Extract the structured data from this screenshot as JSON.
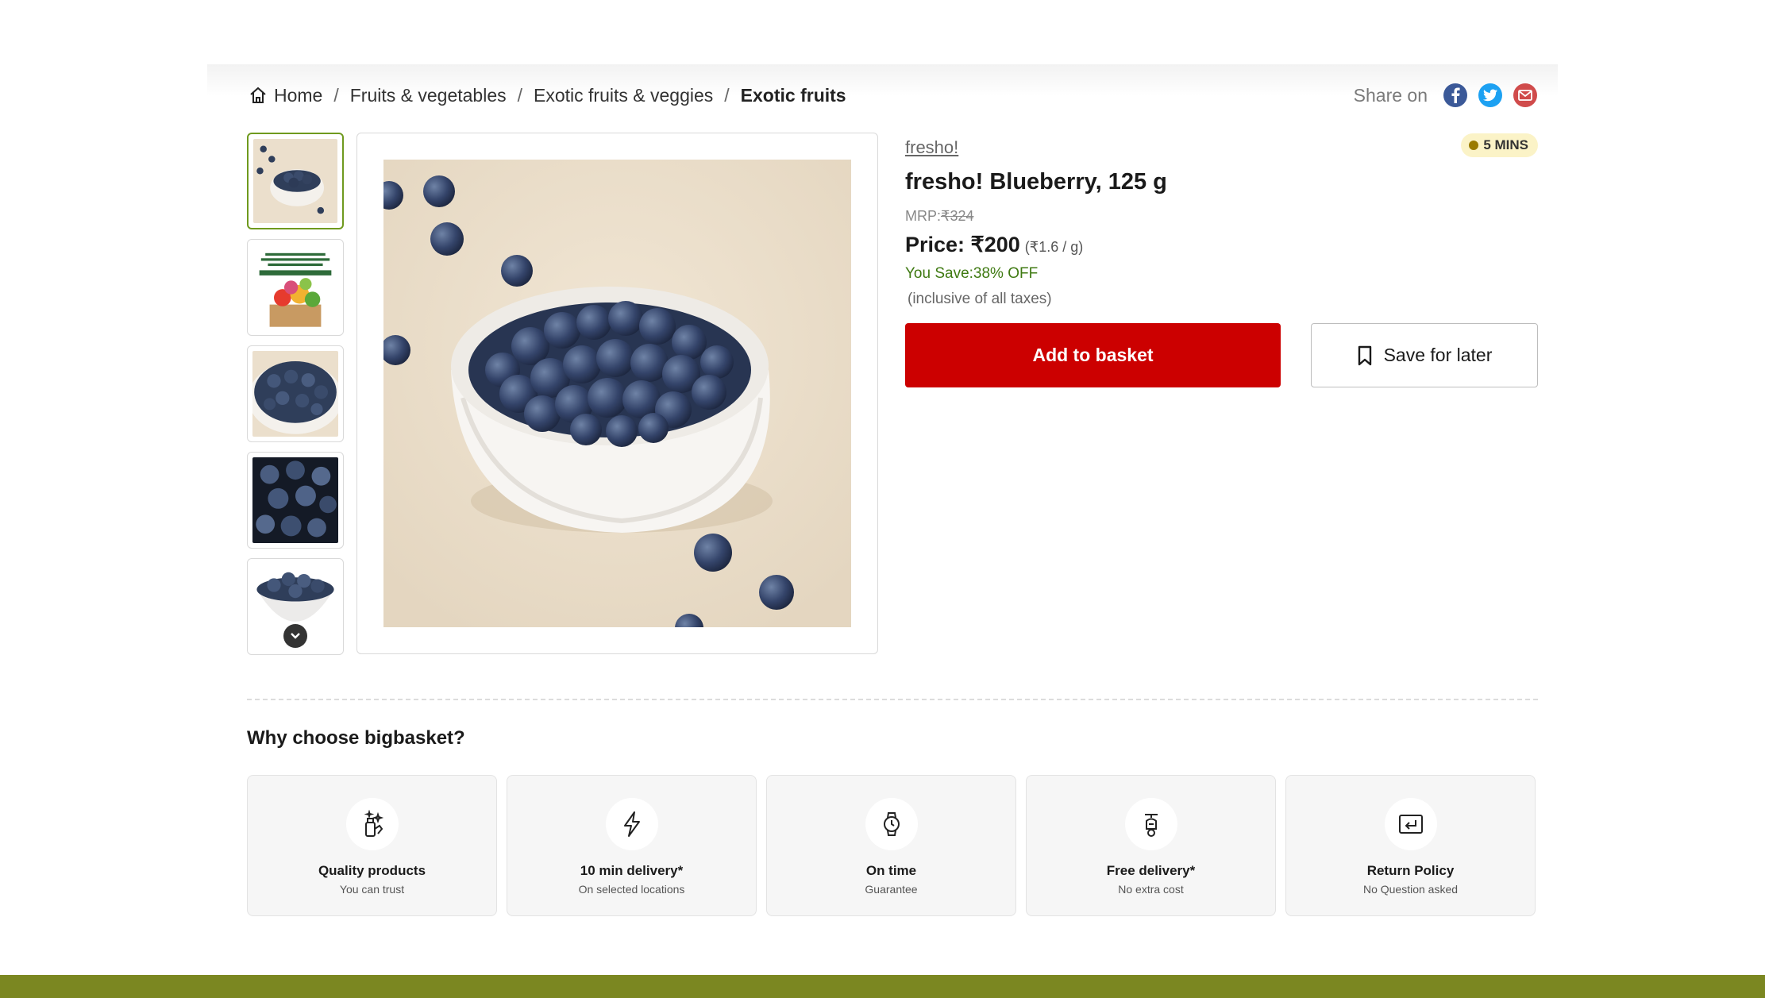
{
  "breadcrumb": {
    "home": "Home",
    "items": [
      "Fruits & vegetables",
      "Exotic fruits & veggies",
      "Exotic fruits"
    ],
    "separator": "/"
  },
  "share": {
    "label": "Share on",
    "icons": [
      "facebook-icon",
      "twitter-icon",
      "email-icon"
    ]
  },
  "product": {
    "brand": "fresho!",
    "eta": "5 MINS",
    "title": "fresho! Blueberry, 125 g",
    "mrp_label": "MRP:",
    "mrp_value": "₹324",
    "price_label": "Price: ₹200",
    "per_unit": "(₹1.6 / g)",
    "save": "You Save:38% OFF",
    "taxes": "(inclusive of all taxes)"
  },
  "actions": {
    "add": "Add to basket",
    "save_later": "Save for later"
  },
  "why": {
    "title": "Why choose bigbasket?",
    "features": [
      {
        "title": "Quality products",
        "sub": "You can trust",
        "icon": "quality-icon"
      },
      {
        "title": "10 min delivery*",
        "sub": "On selected locations",
        "icon": "lightning-icon"
      },
      {
        "title": "On time",
        "sub": "Guarantee",
        "icon": "watch-icon"
      },
      {
        "title": "Free delivery*",
        "sub": "No extra cost",
        "icon": "scooter-icon"
      },
      {
        "title": "Return Policy",
        "sub": "No Question asked",
        "icon": "return-icon"
      }
    ]
  },
  "colors": {
    "accent_red": "#cc0000",
    "thumb_active": "#6f9a1e",
    "save_green": "#3f7a12",
    "footer_olive": "#7b8721"
  }
}
